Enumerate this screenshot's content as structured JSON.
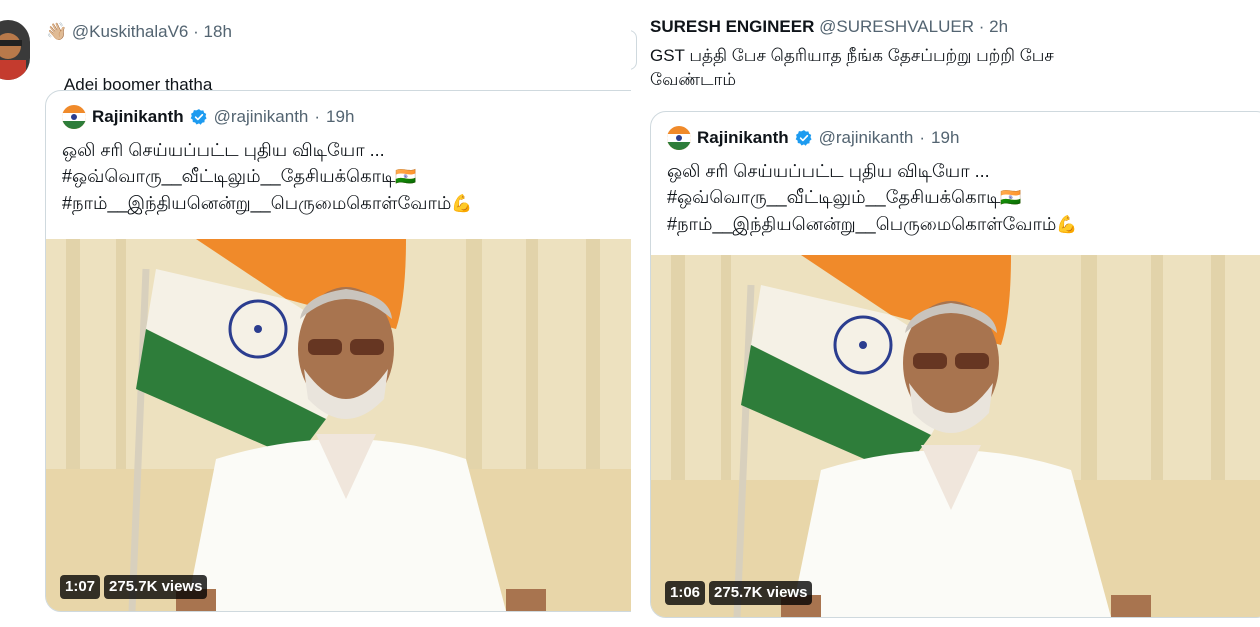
{
  "left": {
    "author_emoji": "👋🏼",
    "handle": "@KuskithalaV6",
    "separator": "·",
    "time": "18h",
    "text": "Adei boomer thatha",
    "reaction_emojis": "😭🤣😂",
    "quote": {
      "name": "Rajinikanth",
      "handle": "@rajinikanth",
      "separator": "·",
      "time": "19h",
      "lines": [
        "ஒலி சரி செய்யப்பட்ட புதிய விடியோ ...",
        "#ஒவ்வொரு__வீட்டிலும்__தேசியக்கொடி",
        "#நாம்__இந்தியனென்று__பெருமைகொள்வோம்"
      ],
      "flag_emoji": "🇮🇳",
      "strong_emoji": "💪",
      "video_duration": "1:07",
      "video_views": "275.7K views"
    }
  },
  "right": {
    "name": "SURESH ENGINEER",
    "handle": "@SURESHVALUER",
    "separator": "·",
    "time": "2h",
    "text": "GST பத்தி பேச தெரியாத நீங்க தேசப்பற்று பற்றி பேச\nவேண்டாம்",
    "quote": {
      "name": "Rajinikanth",
      "handle": "@rajinikanth",
      "separator": "·",
      "time": "19h",
      "lines": [
        "ஒலி சரி செய்யப்பட்ட புதிய விடியோ ...",
        "#ஒவ்வொரு__வீட்டிலும்__தேசியக்கொடி",
        "#நாம்__இந்தியனென்று__பெருமைகொள்வோம்"
      ],
      "flag_emoji": "🇮🇳",
      "strong_emoji": "💪",
      "video_duration": "1:06",
      "video_views": "275.7K views"
    }
  },
  "colors": {
    "text": "#0f1419",
    "muted": "#536471",
    "border": "#cfd9de",
    "verified": "#1d9bf0",
    "saffron": "#f08a2a",
    "green": "#2e7d3a",
    "chakra": "#2b3d8f"
  }
}
